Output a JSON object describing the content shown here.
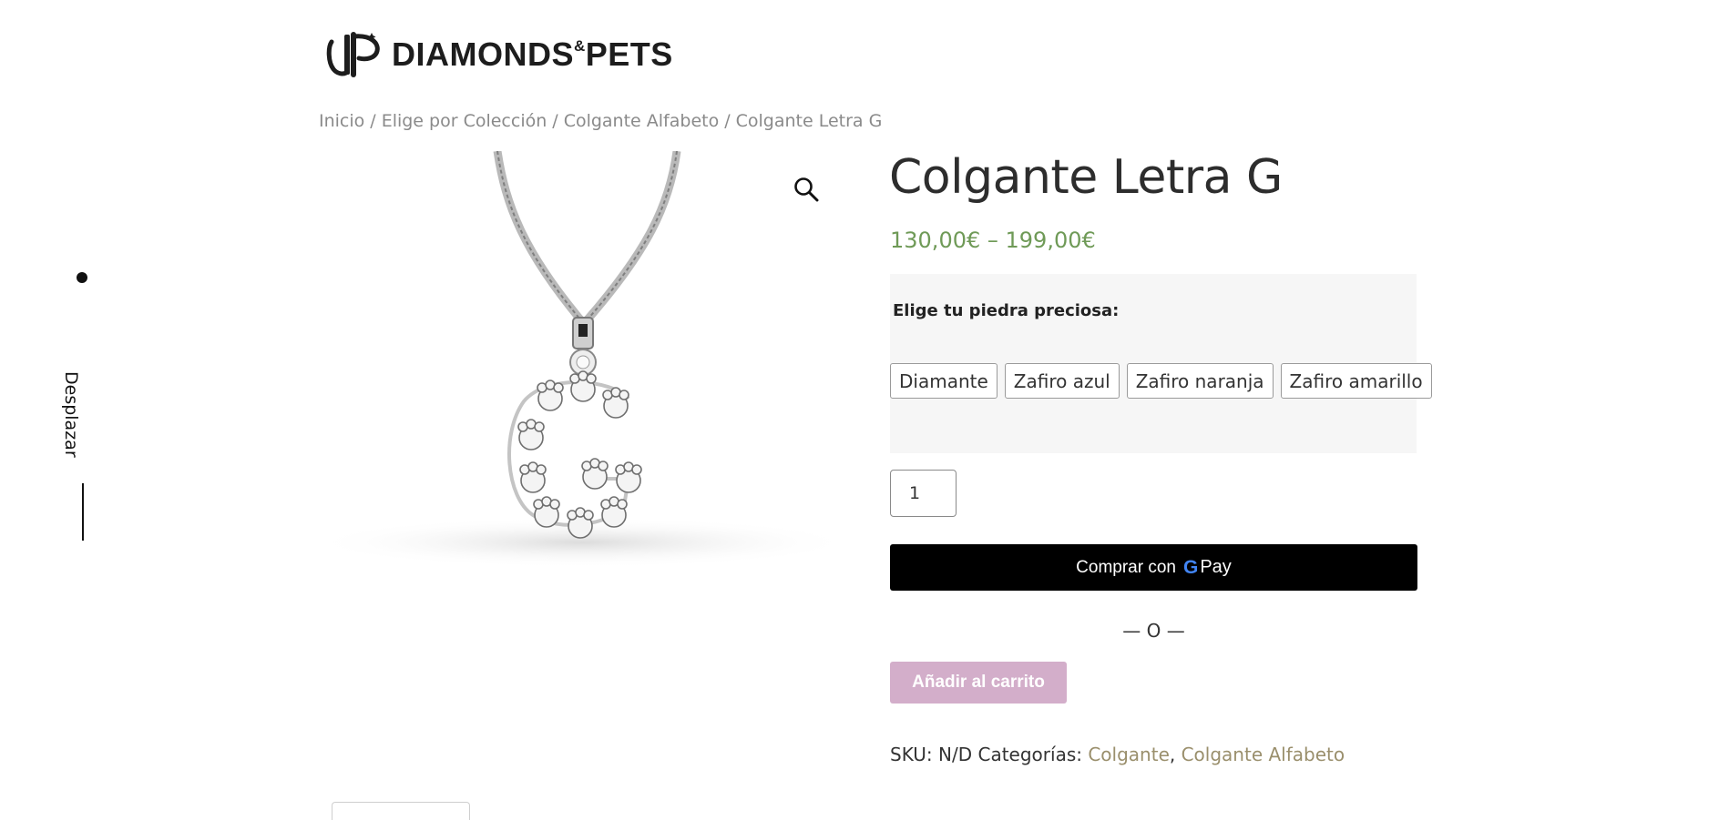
{
  "brand": {
    "name_main": "DIAMONDS",
    "name_amp": "&",
    "name_end": "PETS"
  },
  "breadcrumb": {
    "items": [
      "Inicio",
      "Elige por Colección",
      "Colgante Alfabeto",
      "Colgante Letra G"
    ],
    "separator": "/"
  },
  "side_scroll": {
    "label": "Desplazar"
  },
  "product": {
    "title": "Colgante Letra G",
    "price_range": "130,00€ – 199,00€",
    "variation_label": "Elige tu piedra preciosa:",
    "options": [
      "Diamante",
      "Zafiro azul",
      "Zafiro naranja",
      "Zafiro amarillo"
    ],
    "quantity": "1",
    "gpay_label": "Comprar con",
    "gpay_g": "G",
    "gpay_pay": "Pay",
    "or_separator": "— O —",
    "add_to_cart": "Añadir al carrito",
    "meta": {
      "sku_label": "SKU:",
      "sku_value": "N/D",
      "categories_label": "Categorías:",
      "categories": [
        "Colgante",
        "Colgante Alfabeto"
      ]
    }
  },
  "icons": {
    "zoom": "magnifier-icon",
    "logo": "dp-logo-icon"
  },
  "colors": {
    "price": "#6f9a57",
    "cart_button": "#d3aeca",
    "category_link": "#9a8f6c",
    "gpay_bg": "#000000"
  }
}
